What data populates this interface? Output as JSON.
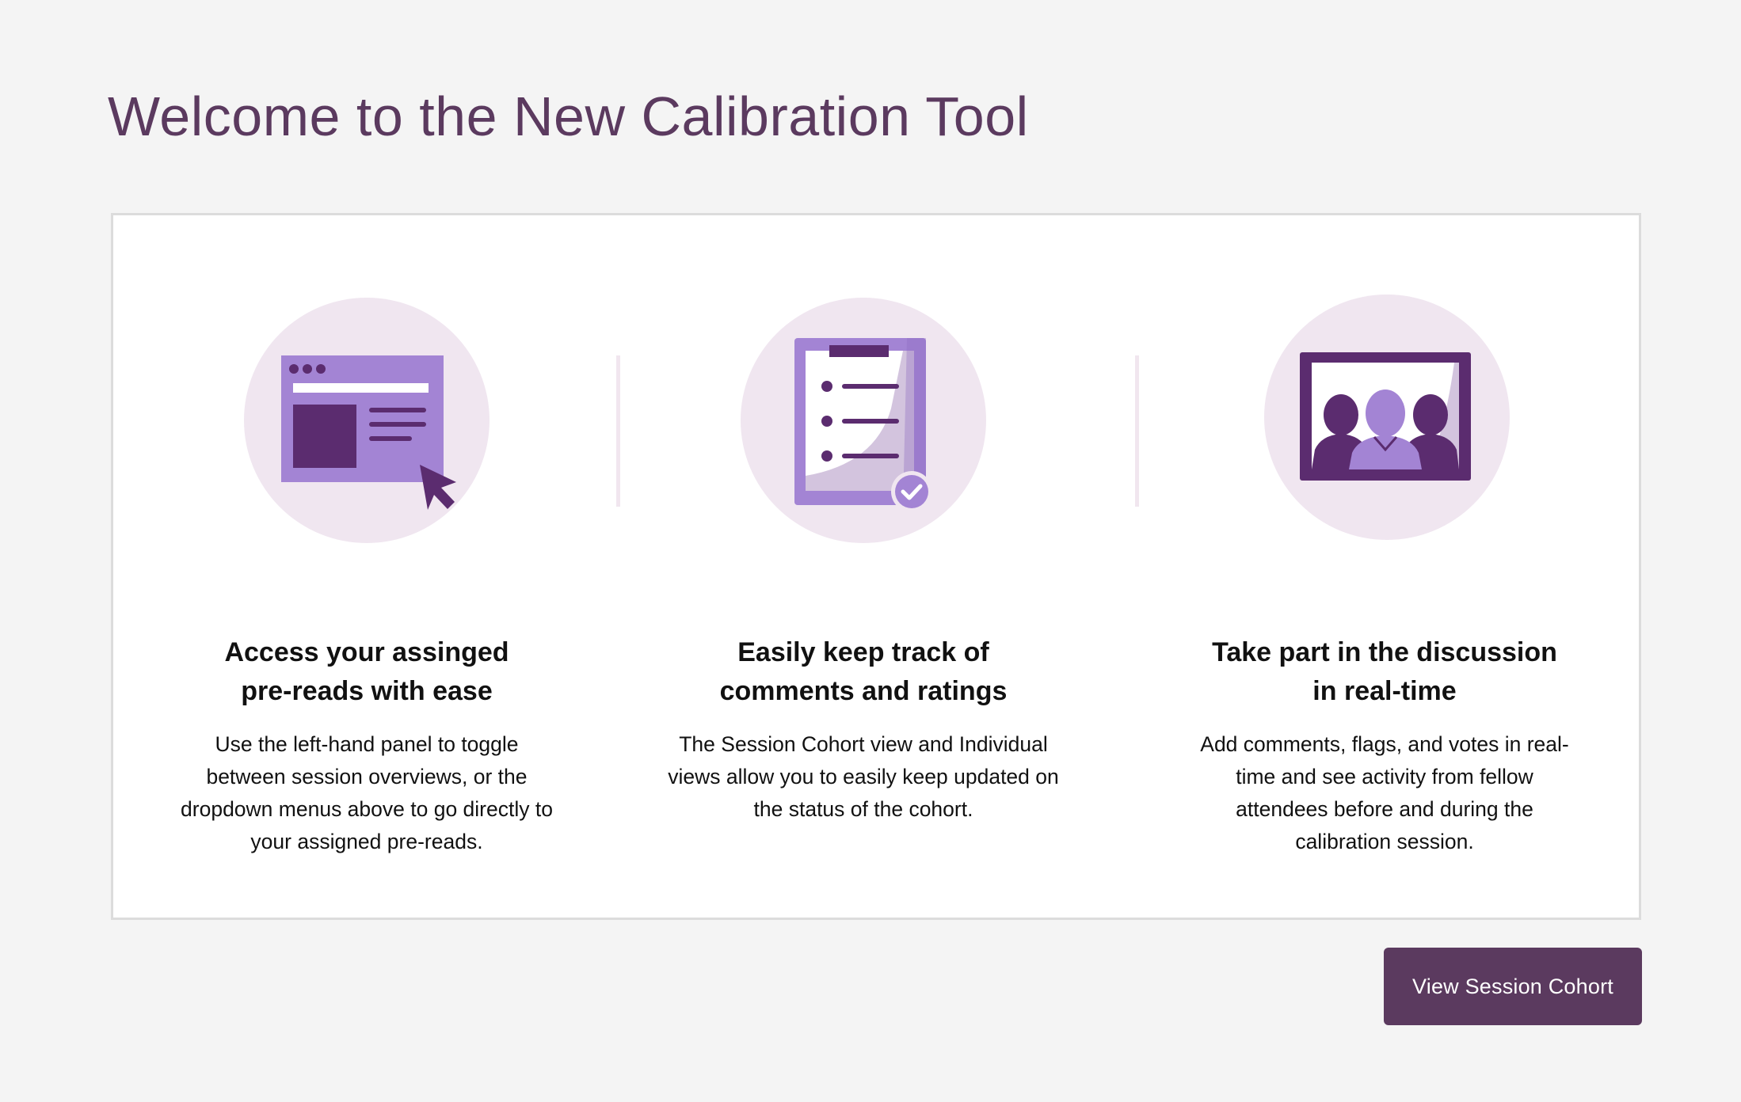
{
  "page": {
    "title": "Welcome to the New Calibration Tool"
  },
  "colors": {
    "brand": "#5b3a5f",
    "illustration_bg": "#f0e6f0",
    "illustration_light": "#a384d4",
    "illustration_dark": "#5b2c6f"
  },
  "features": [
    {
      "icon": "browser-window-cursor-icon",
      "heading_lines": [
        "Access your assinged",
        "pre-reads with ease"
      ],
      "description_lines": [
        "Use the left-hand panel to toggle",
        "between session overviews, or the",
        "dropdown menus above to go directly to",
        "your assigned pre-reads."
      ]
    },
    {
      "icon": "clipboard-checklist-icon",
      "heading_lines": [
        "Easily keep track of",
        "comments and ratings"
      ],
      "description_lines": [
        "The Session Cohort view and Individual",
        "views allow you to easily keep updated on",
        "the status of the cohort."
      ]
    },
    {
      "icon": "group-video-screen-icon",
      "heading_lines": [
        "Take part in the discussion",
        "in real-time"
      ],
      "description_lines": [
        "Add comments, flags, and votes in real-",
        "time and see activity from fellow",
        "attendees before and during the",
        "calibration session."
      ]
    }
  ],
  "actions": {
    "view_session_cohort_label": "View Session Cohort"
  }
}
